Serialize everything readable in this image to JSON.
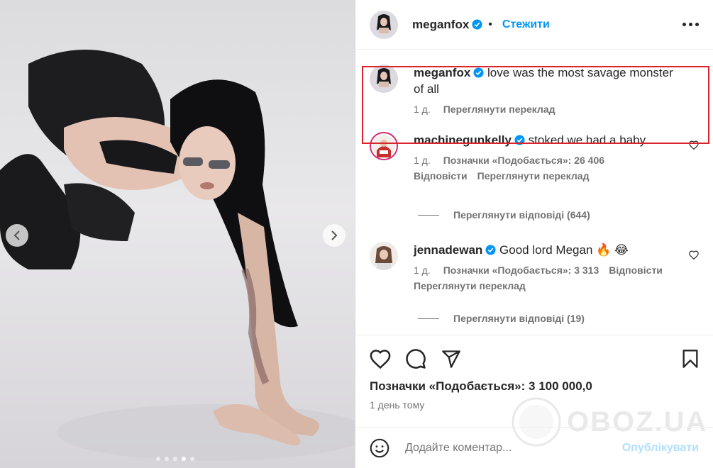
{
  "post": {
    "author": "meganfox",
    "follow_label": "Стежити",
    "separator": "•"
  },
  "caption": {
    "username": "meganfox",
    "text": "love was the most savage monster of all",
    "time": "1 д.",
    "translate": "Переглянути переклад"
  },
  "comments": [
    {
      "username": "machinegunkelly",
      "text": "stoked we had a baby",
      "time": "1 д.",
      "likes": "Позначки «Подобається»: 26 406",
      "reply": "Відповісти",
      "translate": "Переглянути переклад",
      "view_replies": "Переглянути відповіді (644)"
    },
    {
      "username": "jennadewan",
      "text": "Good lord Megan 🔥 😂",
      "time": "1 д.",
      "likes": "Позначки «Подобається»: 3 313",
      "reply": "Відповісти",
      "translate": "Переглянути переклад",
      "view_replies": "Переглянути відповіді (19)"
    }
  ],
  "footer": {
    "likes": "Позначки «Подобається»: 3 100 000,0",
    "time_ago": "1 день тому",
    "add_comment_placeholder": "Додайте коментар...",
    "publish": "Опублікувати"
  },
  "watermark": "OBOZ.UA",
  "colors": {
    "accent": "#0095f6",
    "highlight": "#d9232d",
    "verified": "#0095f6"
  },
  "carousel": {
    "total": 5,
    "current": 4
  }
}
